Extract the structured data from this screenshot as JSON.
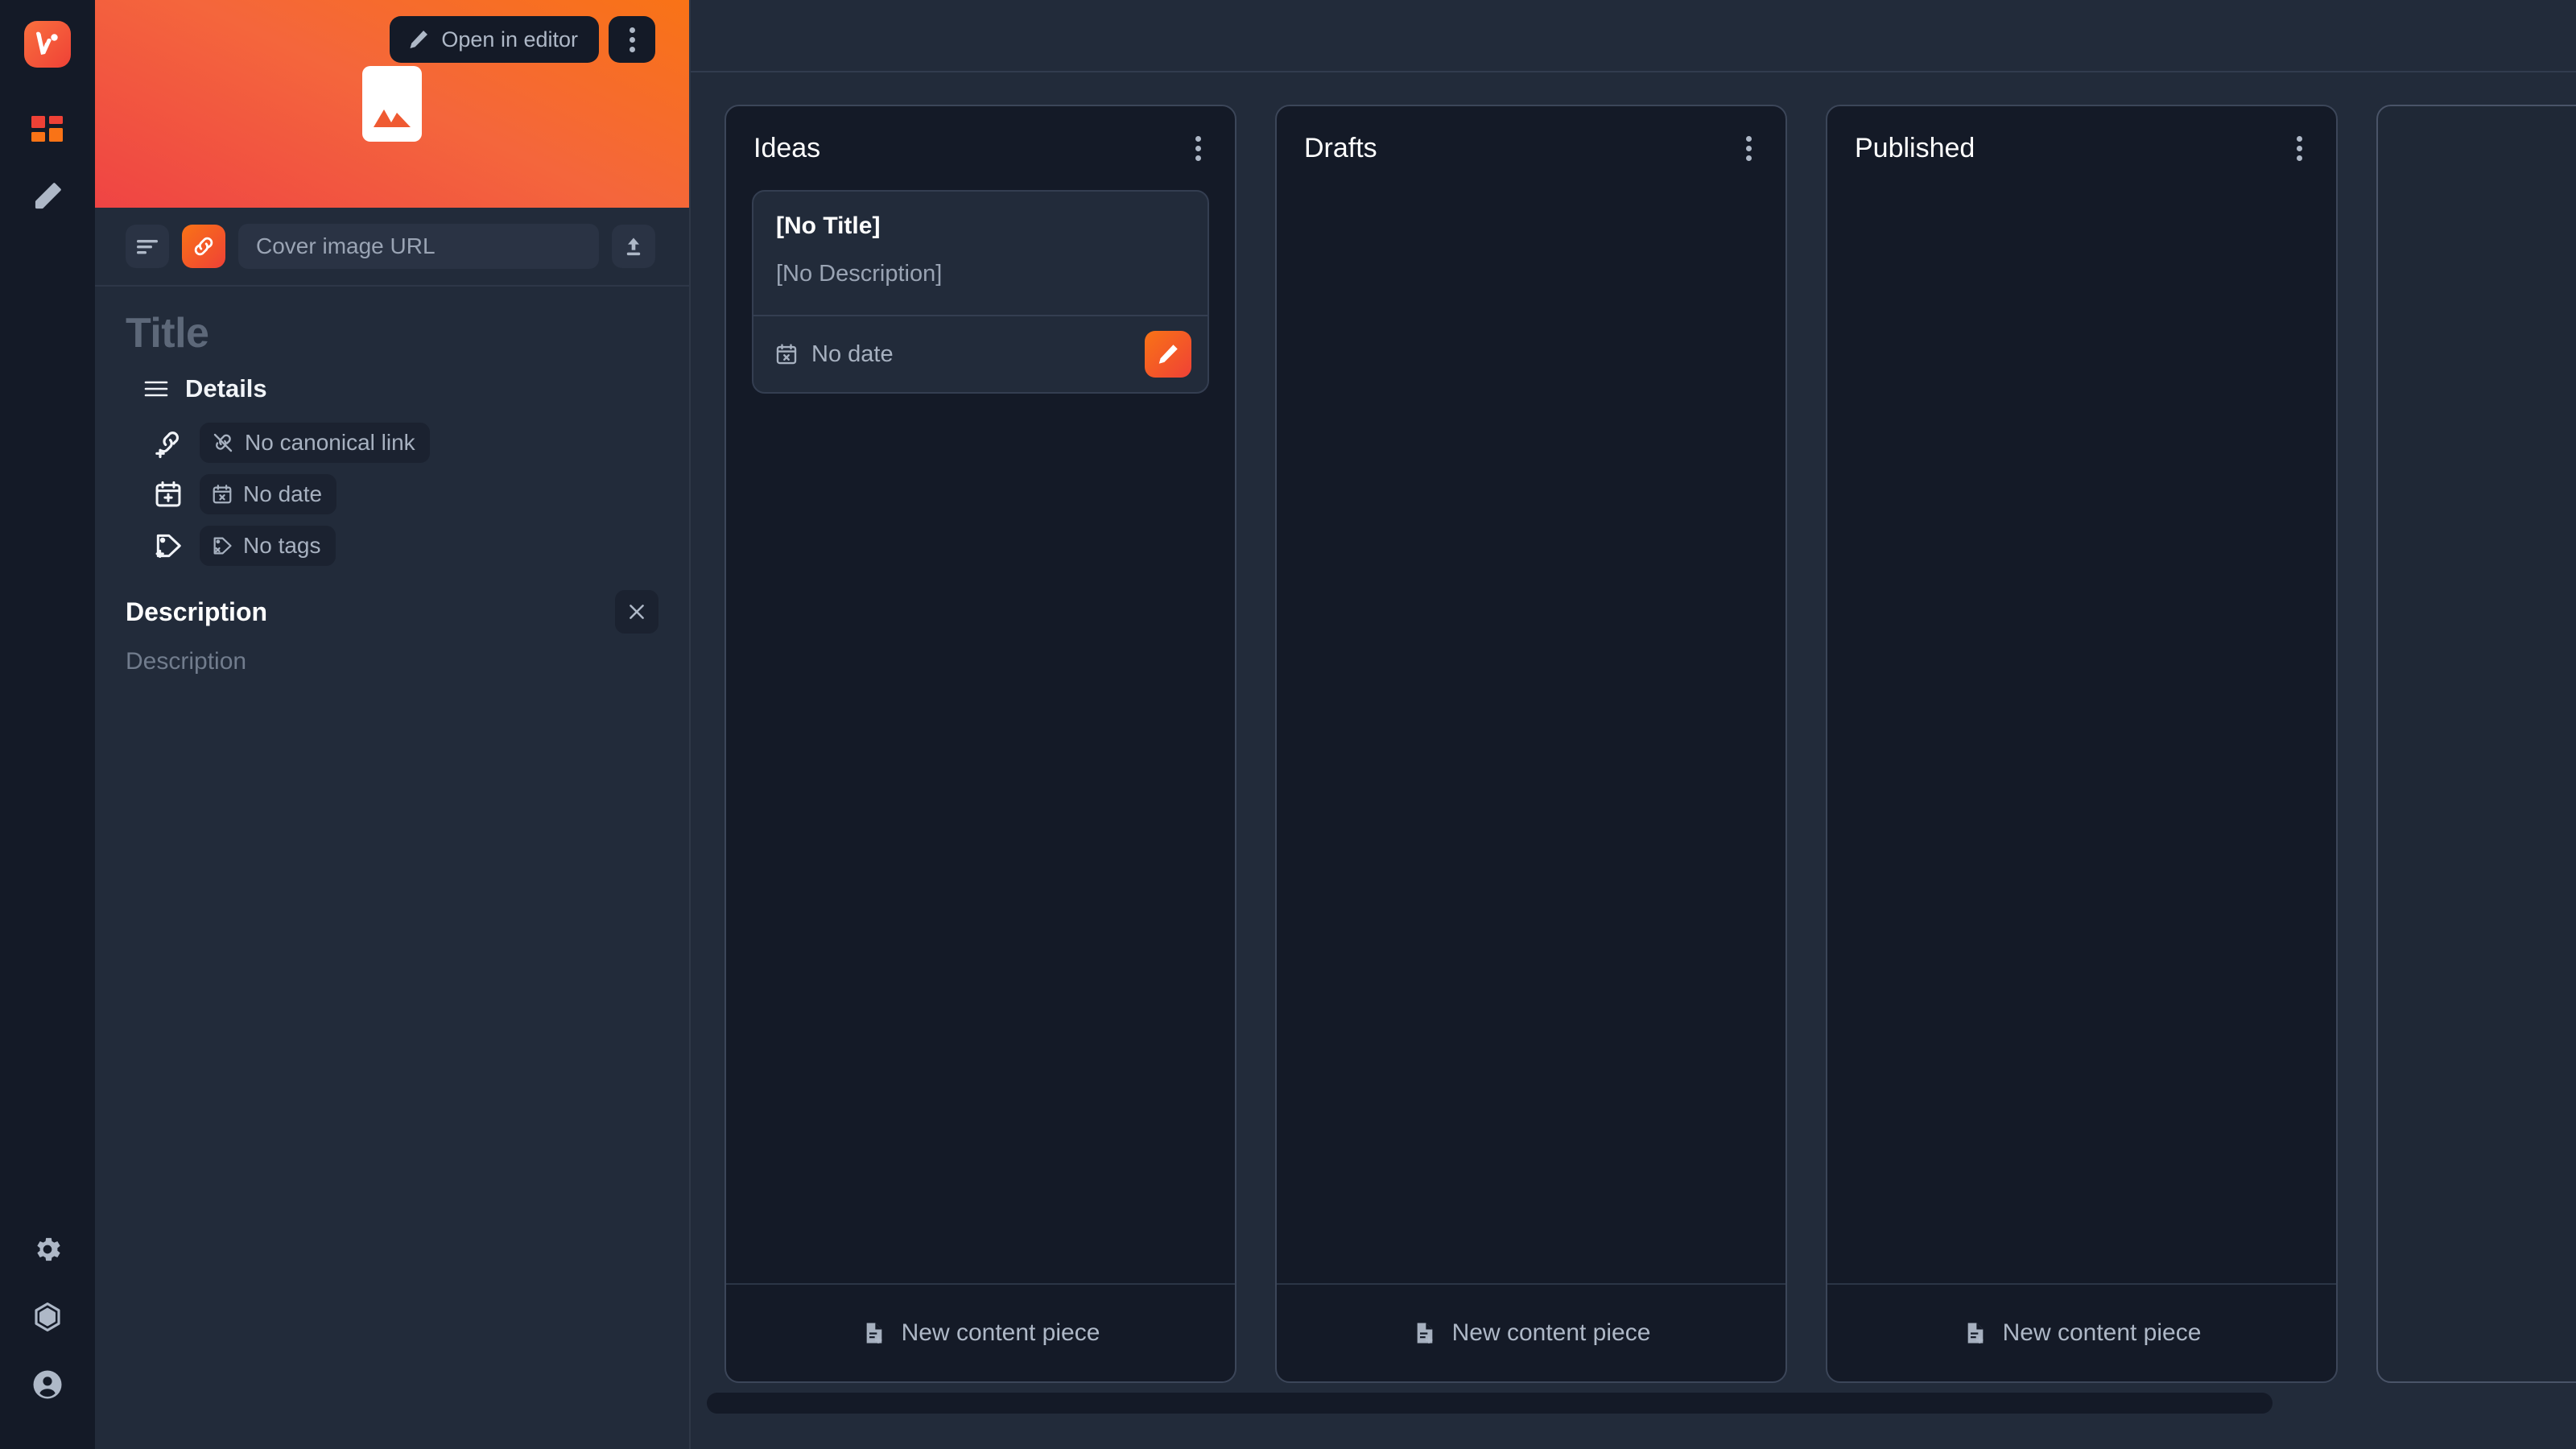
{
  "app": {
    "name": "Vivi",
    "logo_icon": "vivi-logo-icon"
  },
  "rail": {
    "items": [
      {
        "icon": "grid-dashboard-icon",
        "name": "dashboard"
      },
      {
        "icon": "pencil-edit-icon",
        "name": "editor"
      }
    ],
    "bottom_items": [
      {
        "icon": "gear-settings-icon",
        "name": "settings"
      },
      {
        "icon": "hexagon-cube-icon",
        "name": "integrations"
      },
      {
        "icon": "user-account-icon",
        "name": "account"
      }
    ]
  },
  "sidebar": {
    "cover": {
      "open_in_editor_label": "Open in editor",
      "open_in_editor_icon": "pencil-icon",
      "more_icon": "more-vertical-icon",
      "placeholder_icon": "image-placeholder-icon"
    },
    "url_row": {
      "align_icon": "text-align-left-icon",
      "link_icon": "link-chain-icon",
      "cover_url_value": "",
      "cover_url_placeholder": "Cover image URL",
      "upload_icon": "upload-icon"
    },
    "title_placeholder": "Title",
    "details": {
      "label": "Details",
      "menu_icon": "hamburger-menu-icon",
      "rows": [
        {
          "action_icon": "link-add-icon",
          "chip_icon": "link-off-icon",
          "chip_label": "No canonical link"
        },
        {
          "action_icon": "calendar-add-icon",
          "chip_icon": "calendar-off-icon",
          "chip_label": "No date"
        },
        {
          "action_icon": "tag-add-icon",
          "chip_icon": "tag-off-icon",
          "chip_label": "No tags"
        }
      ]
    },
    "description": {
      "heading": "Description",
      "close_icon": "close-x-icon",
      "placeholder": "Description"
    }
  },
  "board": {
    "new_piece_label": "New content piece",
    "new_piece_icon": "file-add-icon",
    "column_menu_icon": "more-vertical-icon",
    "columns": [
      {
        "title": "Ideas",
        "cards": [
          {
            "title": "[No Title]",
            "description": "[No Description]",
            "date_label": "No date",
            "date_icon": "calendar-off-icon",
            "edit_icon": "pencil-icon"
          }
        ]
      },
      {
        "title": "Drafts",
        "cards": []
      },
      {
        "title": "Published",
        "cards": []
      },
      {
        "title": "",
        "cards": []
      }
    ]
  },
  "colors": {
    "accent_orange": "#f97316",
    "accent_red": "#ef4136",
    "rail_bg": "#141a27",
    "panel_bg": "#222b3a",
    "column_bg": "#141a27",
    "text_primary": "#ffffff",
    "text_muted": "#9aa4b4"
  }
}
